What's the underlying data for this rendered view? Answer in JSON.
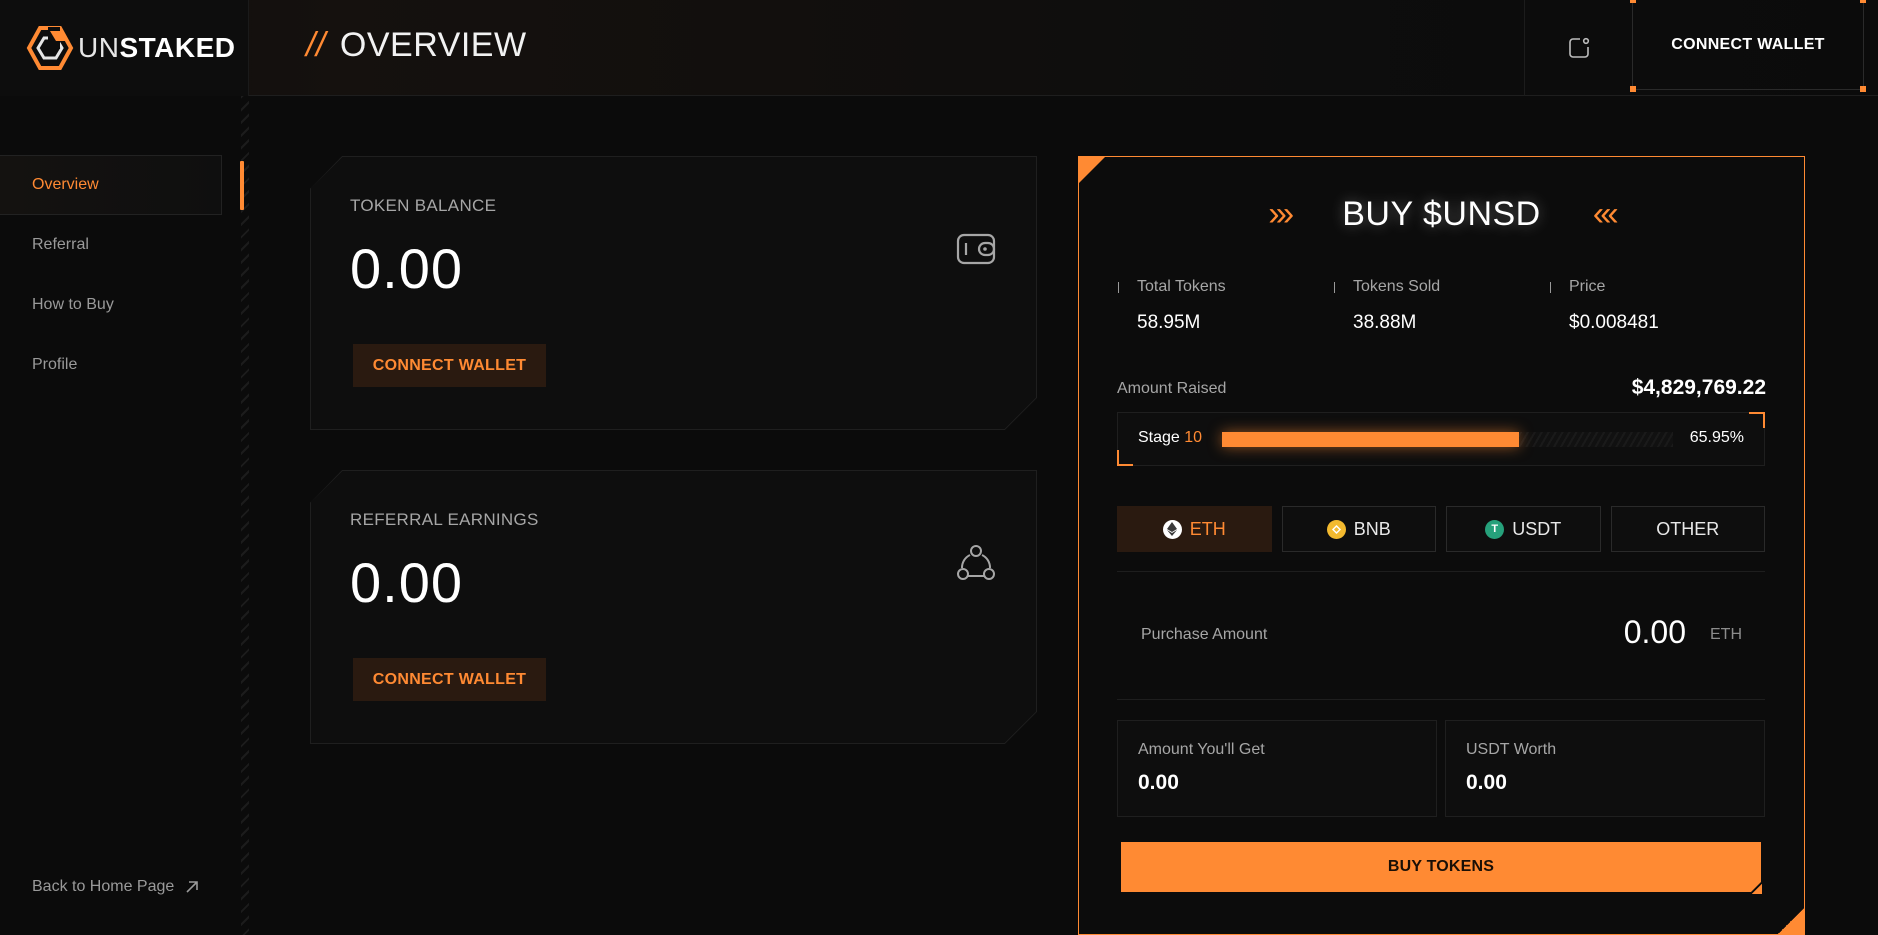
{
  "brand": {
    "light": "UN",
    "bold": "STAKED"
  },
  "header": {
    "title": "OVERVIEW",
    "connect_wallet": "CONNECT WALLET"
  },
  "sidebar": {
    "items": [
      {
        "label": "Overview",
        "active": true
      },
      {
        "label": "Referral",
        "active": false
      },
      {
        "label": "How to Buy",
        "active": false
      },
      {
        "label": "Profile",
        "active": false
      }
    ],
    "back_home": "Back to Home Page"
  },
  "cards": {
    "token_balance": {
      "label": "TOKEN BALANCE",
      "value": "0.00",
      "button": "CONNECT WALLET",
      "icon": "wallet-icon"
    },
    "referral_earnings": {
      "label": "REFERRAL EARNINGS",
      "value": "0.00",
      "button": "CONNECT WALLET",
      "icon": "network-icon"
    }
  },
  "buy": {
    "title": "BUY $UNSD",
    "chevrons_left": "›››",
    "chevrons_right": "‹‹‹",
    "stats": [
      {
        "label": "Total Tokens",
        "value": "58.95M"
      },
      {
        "label": "Tokens Sold",
        "value": "38.88M"
      },
      {
        "label": "Price",
        "value": "$0.008481"
      }
    ],
    "amount_raised_label": "Amount Raised",
    "amount_raised": "$4,829,769.22",
    "stage_label": "Stage",
    "stage_number": "10",
    "progress_percent": 65.95,
    "progress_text": "65.95%",
    "currencies": [
      {
        "label": "ETH",
        "icon": "eth-icon",
        "active": true
      },
      {
        "label": "BNB",
        "icon": "bnb-icon",
        "active": false
      },
      {
        "label": "USDT",
        "icon": "usdt-icon",
        "active": false
      },
      {
        "label": "OTHER",
        "icon": "",
        "active": false
      }
    ],
    "purchase_label": "Purchase Amount",
    "purchase_value": "0.00",
    "purchase_unit": "ETH",
    "get_label": "Amount You'll Get",
    "get_value": "0.00",
    "usdt_label": "USDT Worth",
    "usdt_value": "0.00",
    "buy_button": "BUY TOKENS"
  },
  "colors": {
    "accent": "#ff8a33",
    "background": "#0b0b0b",
    "button_dark": "#2a1a10",
    "bnb": "#f3ba2f",
    "usdt": "#26a17b"
  }
}
